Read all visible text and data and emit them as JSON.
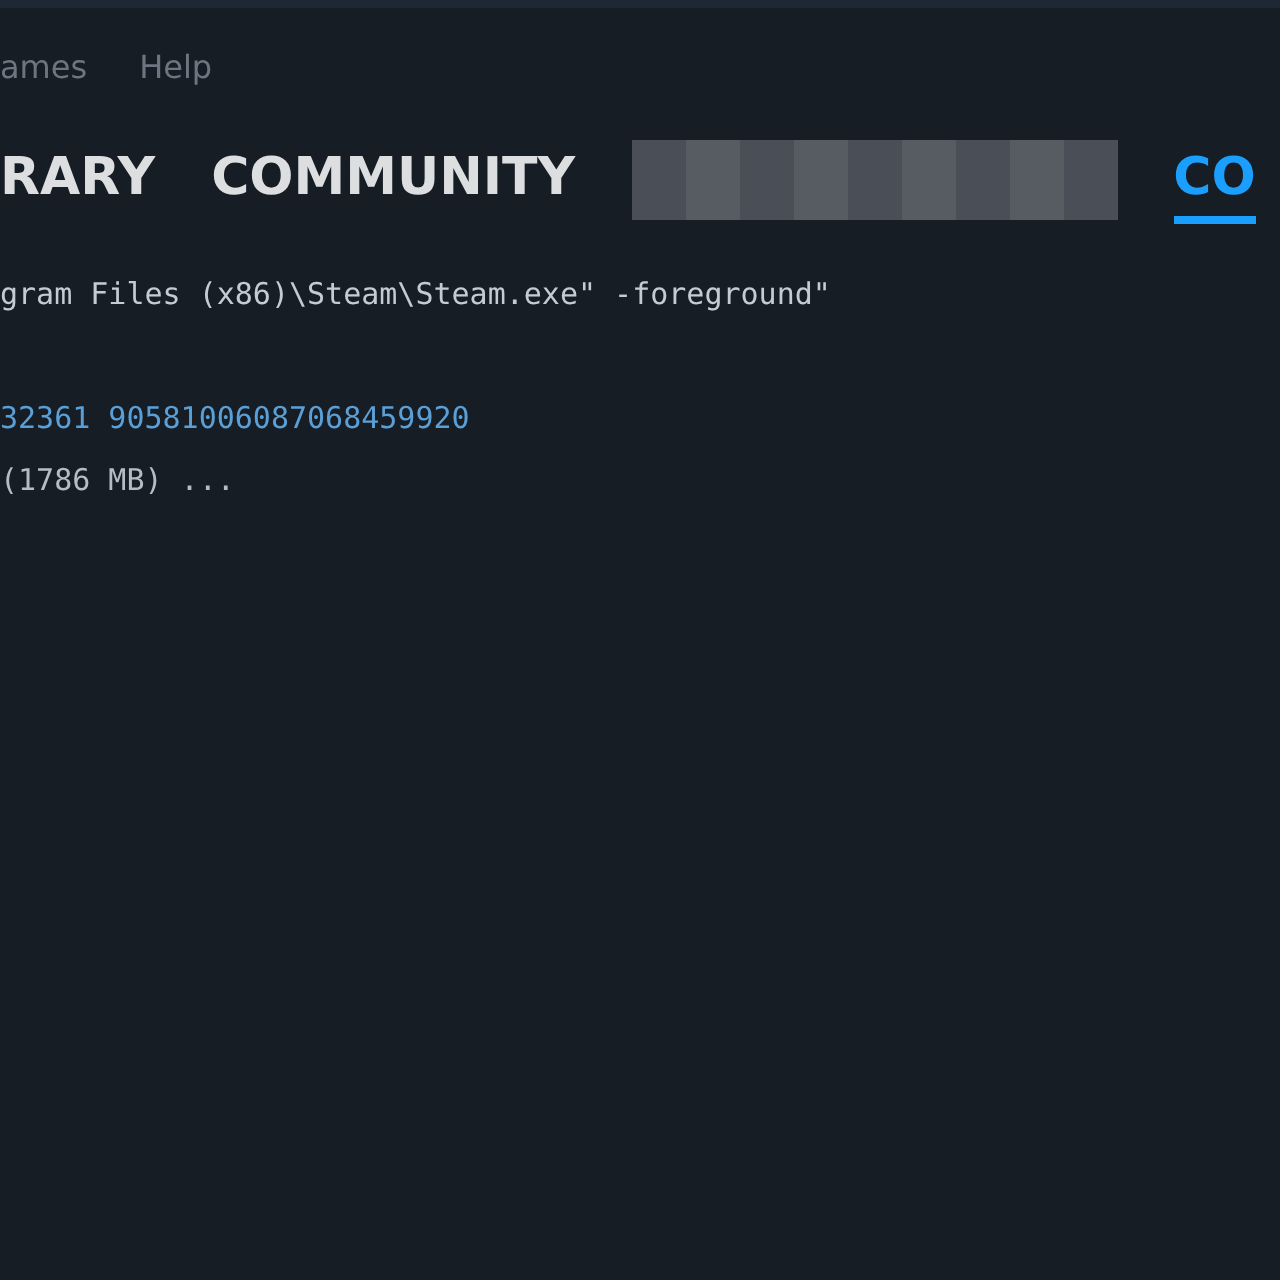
{
  "menu": [
    "ames",
    "Help"
  ],
  "tabs": [
    {
      "kind": "label",
      "label": "RARY",
      "selected": false
    },
    {
      "kind": "label",
      "label": "COMMUNITY",
      "selected": false
    },
    {
      "kind": "blurred",
      "selected": false
    },
    {
      "kind": "label",
      "label": "CO",
      "selected": true
    }
  ],
  "console_lines": [
    {
      "kind": "command",
      "text": "gram Files (x86)\\Steam\\Steam.exe\" -foreground\""
    },
    {
      "kind": "id",
      "text": "32361 90581006087068459920"
    },
    {
      "kind": "status",
      "text": "(1786 MB) ..."
    }
  ]
}
